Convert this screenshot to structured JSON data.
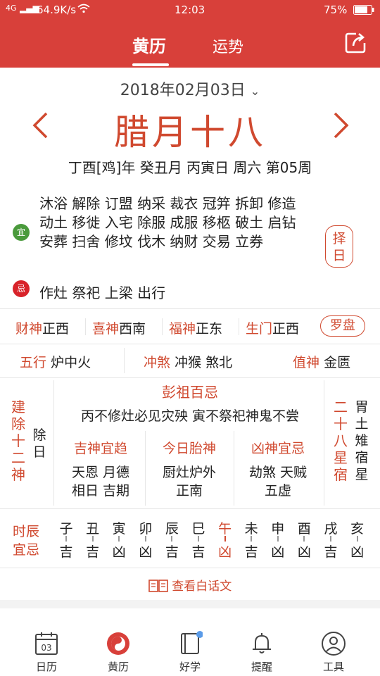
{
  "status": {
    "net": "4G",
    "speed": "64.9K/s",
    "time": "12:03",
    "battery": "75%"
  },
  "tabs": [
    {
      "label": "黄历"
    },
    {
      "label": "运势"
    }
  ],
  "date": "2018年02月03日",
  "date_chevron": "⌄",
  "lunar": "腊月十八",
  "ganzhi": "丁酉[鸡]年 癸丑月 丙寅日 周六 第05周",
  "yi": {
    "badge": "宜",
    "items": "沐浴 解除 订盟 纳采 裁衣 冠笄 拆卸 修造 动土 移徙 入宅 除服 成服 移柩 破土 启钻 安葬 扫舍 修坟 伐木 纳财 交易 立券"
  },
  "ji": {
    "badge": "忌",
    "items": "作灶 祭祀 上梁 出行"
  },
  "zeri": {
    "line1": "择",
    "line2": "日"
  },
  "gods": [
    {
      "label": "财神",
      "value": "正西"
    },
    {
      "label": "喜神",
      "value": "西南"
    },
    {
      "label": "福神",
      "value": "正东"
    },
    {
      "label": "生门",
      "value": "正西"
    }
  ],
  "luopan": "罗盘",
  "wuxing": {
    "label": "五行",
    "value": "炉中火"
  },
  "chongsha": {
    "label": "冲煞",
    "value": "冲猴 煞北"
  },
  "zhishen": {
    "label": "值神",
    "value": "金匮"
  },
  "jianchu": {
    "label": "建除十二神",
    "value": "除日"
  },
  "pengzu": {
    "title": "彭祖百忌",
    "text": "丙不修灶必见灾殃 寅不祭祀神鬼不尝"
  },
  "jishen": {
    "title": "吉神宜趋",
    "line1": "天恩 月德",
    "line2": "相日 吉期"
  },
  "taishen": {
    "title": "今日胎神",
    "line1": "厨灶炉外",
    "line2": "正南"
  },
  "xiongshen": {
    "title": "凶神宜忌",
    "line1": "劫煞 天贼",
    "line2": "五虚"
  },
  "xingxiu": {
    "label": "二十八星宿",
    "value": "胃土雉宿星"
  },
  "shichen": {
    "label1": "时辰",
    "label2": "宜忌",
    "hours": [
      {
        "zhi": "子",
        "luck": "吉"
      },
      {
        "zhi": "丑",
        "luck": "吉"
      },
      {
        "zhi": "寅",
        "luck": "凶"
      },
      {
        "zhi": "卯",
        "luck": "凶"
      },
      {
        "zhi": "辰",
        "luck": "吉"
      },
      {
        "zhi": "巳",
        "luck": "吉"
      },
      {
        "zhi": "午",
        "luck": "凶"
      },
      {
        "zhi": "未",
        "luck": "吉"
      },
      {
        "zhi": "申",
        "luck": "凶"
      },
      {
        "zhi": "酉",
        "luck": "凶"
      },
      {
        "zhi": "戌",
        "luck": "吉"
      },
      {
        "zhi": "亥",
        "luck": "凶"
      }
    ]
  },
  "baihua": "查看白话文",
  "calendar_icon_day": "03",
  "nav": [
    {
      "label": "日历"
    },
    {
      "label": "黄历"
    },
    {
      "label": "好学"
    },
    {
      "label": "提醒"
    },
    {
      "label": "工具"
    }
  ],
  "colors": {
    "brand": "#d8403a",
    "accent": "#d0492f",
    "yi": "#4a9a3c",
    "ji": "#d8232a"
  }
}
